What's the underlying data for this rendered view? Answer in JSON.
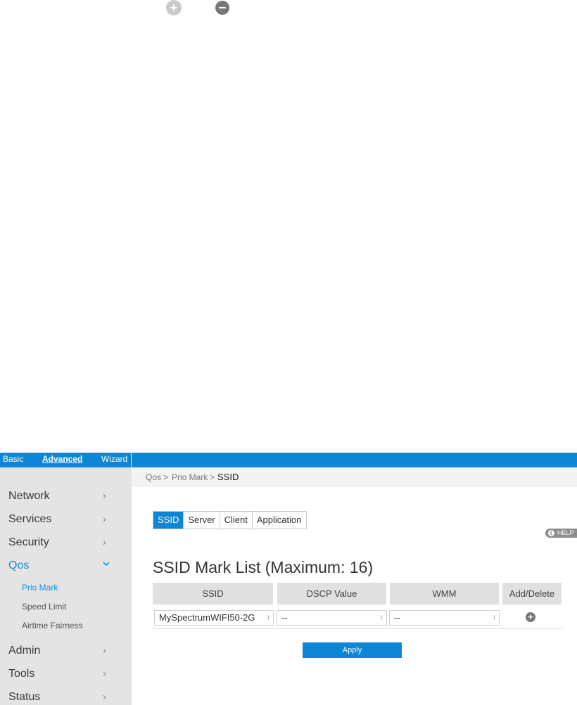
{
  "floating_icons": {
    "add": "plus-circle-icon",
    "remove": "minus-circle-icon"
  },
  "topnav": {
    "basic": "Basic",
    "advanced": "Advanced",
    "wizard": "Wizard"
  },
  "sidebar": {
    "items": [
      {
        "label": "Network",
        "chevron": ">"
      },
      {
        "label": "Services",
        "chevron": ">"
      },
      {
        "label": "Security",
        "chevron": ">"
      },
      {
        "label": "Qos",
        "chevron": "v"
      },
      {
        "label": "Admin",
        "chevron": ">"
      },
      {
        "label": "Tools",
        "chevron": ">"
      },
      {
        "label": "Status",
        "chevron": ">"
      }
    ],
    "subitems": [
      "Prio Mark",
      "Speed Limit",
      "Airtime Fairness"
    ]
  },
  "breadcrumb": {
    "part1": "Qos",
    "sep1": ">",
    "part2": "Prio Mark",
    "sep2": ">",
    "current": "SSID"
  },
  "tabs": [
    "SSID",
    "Server",
    "Client",
    "Application"
  ],
  "help": {
    "label": "HELP"
  },
  "title": "SSID Mark List (Maximum: 16)",
  "table": {
    "headers": [
      "SSID",
      "DSCP Value",
      "WMM",
      "Add/Delete"
    ],
    "row": {
      "ssid": "MySpectrumWIFI50-2G",
      "dscp": "--",
      "wmm": "--"
    }
  },
  "apply_label": "Apply",
  "colors": {
    "accent": "#0f85d6",
    "sidebar_bg": "#e4e4e4",
    "active_text": "#1b8ee0"
  }
}
